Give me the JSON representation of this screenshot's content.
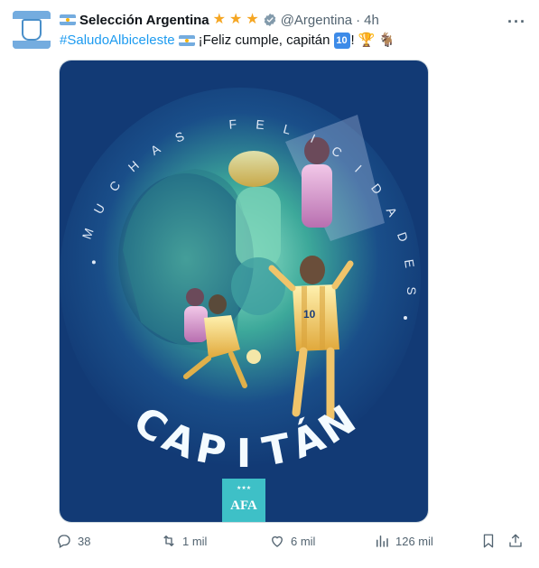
{
  "tweet": {
    "author_name": "Selección Argentina",
    "handle": "@Argentina",
    "separator": "·",
    "time": "4h",
    "more_label": "···",
    "hashtag": "#SaludoAlbiceleste",
    "text_main": "¡Feliz cumple, capitán",
    "text_badge": "10",
    "text_end": "!",
    "emoji_trophy": "🏆",
    "emoji_goat": "🐐"
  },
  "media": {
    "arc_letters": [
      "M",
      "U",
      "C",
      "H",
      "A",
      "S",
      " ",
      "F",
      "E",
      "L",
      "I",
      "C",
      "I",
      "D",
      "A",
      "D",
      "E",
      "S"
    ],
    "arc_text": "MUCHAS FELICIDADES",
    "main_word": "CAPITÁN",
    "logo_text": "AFA",
    "background_color": "#123a75",
    "glow_color": "#8fe0c6"
  },
  "actions": {
    "replies": "38",
    "retweets": "1 mil",
    "likes": "6 mil",
    "views": "126 mil"
  },
  "colors": {
    "accent": "#1d9bf0",
    "muted": "#536471",
    "star": "#f5a623"
  }
}
